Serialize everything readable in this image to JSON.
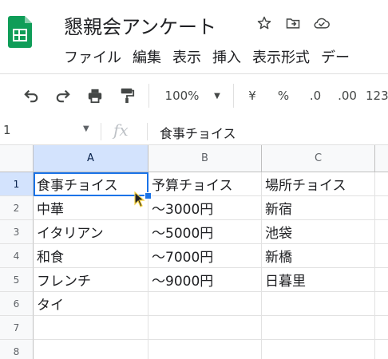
{
  "app": {
    "title": "懇親会アンケート",
    "logo_icon": "google-sheets-logo",
    "title_icons": [
      "star-icon",
      "move-to-folder-icon",
      "cloud-status-icon"
    ],
    "accent": "#1a73e8",
    "logo_color": "#0f9d58"
  },
  "menu": [
    "ファイル",
    "編集",
    "表示",
    "挿入",
    "表示形式",
    "デー"
  ],
  "toolbar": {
    "zoom": "100%",
    "currency": "¥",
    "percent": "%",
    "decrease_decimal": ".0",
    "increase_decimal": ".00",
    "more_formats": "123"
  },
  "formula_bar": {
    "name_box": "1",
    "fx": "fx",
    "content": "食事チョイス"
  },
  "sheet": {
    "columns": [
      "A",
      "B",
      "C"
    ],
    "row_numbers": [
      "1",
      "2",
      "3",
      "4",
      "5",
      "6",
      "7",
      "8"
    ],
    "rows": [
      [
        "食事チョイス",
        "予算チョイス",
        "場所チョイス"
      ],
      [
        "中華",
        "～3000円",
        "新宿"
      ],
      [
        "イタリアン",
        "～5000円",
        "池袋"
      ],
      [
        "和食",
        "～7000円",
        "新橋"
      ],
      [
        "フレンチ",
        "～9000円",
        "日暮里"
      ],
      [
        "タイ",
        "",
        ""
      ],
      [
        "",
        "",
        ""
      ],
      [
        "",
        "",
        ""
      ]
    ],
    "active_cell": "A1"
  }
}
